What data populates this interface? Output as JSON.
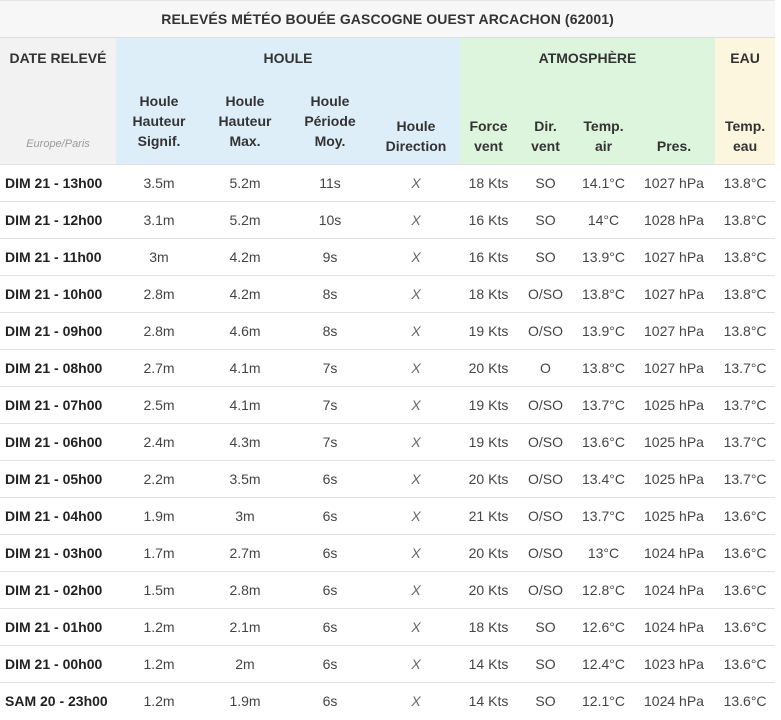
{
  "title": "RELEVÉS MÉTÉO BOUÉE GASCOGNE OUEST ARCACHON (62001)",
  "groups": {
    "date": "DATE RELEVÉ",
    "houle": "HOULE",
    "atmosphere": "ATMOSPHÈRE",
    "eau": "EAU"
  },
  "timezone": "Europe/Paris",
  "columns": {
    "hs_l1": "Houle",
    "hs_l2": "Hauteur",
    "hs_l3": "Signif.",
    "hmax_l1": "Houle",
    "hmax_l2": "Hauteur",
    "hmax_l3": "Max.",
    "per_l1": "Houle",
    "per_l2": "Période",
    "per_l3": "Moy.",
    "dir_l1": "Houle",
    "dir_l2": "Direction",
    "wind_l1": "Force",
    "wind_l2": "vent",
    "wdir_l1": "Dir.",
    "wdir_l2": "vent",
    "tair_l1": "Temp.",
    "tair_l2": "air",
    "pres": "Pres.",
    "teau_l1": "Temp.",
    "teau_l2": "eau"
  },
  "rows": [
    {
      "date": "DIM 21 - 13h00",
      "hs": "3.5m",
      "hmax": "5.2m",
      "period": "11s",
      "direction": "X",
      "wind": "18 Kts",
      "wind_dir": "SO",
      "t_air": "14.1°C",
      "pressure": "1027 hPa",
      "t_water": "13.8°C"
    },
    {
      "date": "DIM 21 - 12h00",
      "hs": "3.1m",
      "hmax": "5.2m",
      "period": "10s",
      "direction": "X",
      "wind": "16 Kts",
      "wind_dir": "SO",
      "t_air": "14°C",
      "pressure": "1028 hPa",
      "t_water": "13.8°C"
    },
    {
      "date": "DIM 21 - 11h00",
      "hs": "3m",
      "hmax": "4.2m",
      "period": "9s",
      "direction": "X",
      "wind": "16 Kts",
      "wind_dir": "SO",
      "t_air": "13.9°C",
      "pressure": "1027 hPa",
      "t_water": "13.8°C"
    },
    {
      "date": "DIM 21 - 10h00",
      "hs": "2.8m",
      "hmax": "4.2m",
      "period": "8s",
      "direction": "X",
      "wind": "18 Kts",
      "wind_dir": "O/SO",
      "t_air": "13.8°C",
      "pressure": "1027 hPa",
      "t_water": "13.8°C"
    },
    {
      "date": "DIM 21 - 09h00",
      "hs": "2.8m",
      "hmax": "4.6m",
      "period": "8s",
      "direction": "X",
      "wind": "19 Kts",
      "wind_dir": "O/SO",
      "t_air": "13.9°C",
      "pressure": "1027 hPa",
      "t_water": "13.8°C"
    },
    {
      "date": "DIM 21 - 08h00",
      "hs": "2.7m",
      "hmax": "4.1m",
      "period": "7s",
      "direction": "X",
      "wind": "20 Kts",
      "wind_dir": "O",
      "t_air": "13.8°C",
      "pressure": "1027 hPa",
      "t_water": "13.7°C"
    },
    {
      "date": "DIM 21 - 07h00",
      "hs": "2.5m",
      "hmax": "4.1m",
      "period": "7s",
      "direction": "X",
      "wind": "19 Kts",
      "wind_dir": "O/SO",
      "t_air": "13.7°C",
      "pressure": "1025 hPa",
      "t_water": "13.7°C"
    },
    {
      "date": "DIM 21 - 06h00",
      "hs": "2.4m",
      "hmax": "4.3m",
      "period": "7s",
      "direction": "X",
      "wind": "19 Kts",
      "wind_dir": "O/SO",
      "t_air": "13.6°C",
      "pressure": "1025 hPa",
      "t_water": "13.7°C"
    },
    {
      "date": "DIM 21 - 05h00",
      "hs": "2.2m",
      "hmax": "3.5m",
      "period": "6s",
      "direction": "X",
      "wind": "20 Kts",
      "wind_dir": "O/SO",
      "t_air": "13.4°C",
      "pressure": "1025 hPa",
      "t_water": "13.7°C"
    },
    {
      "date": "DIM 21 - 04h00",
      "hs": "1.9m",
      "hmax": "3m",
      "period": "6s",
      "direction": "X",
      "wind": "21 Kts",
      "wind_dir": "O/SO",
      "t_air": "13.7°C",
      "pressure": "1025 hPa",
      "t_water": "13.6°C"
    },
    {
      "date": "DIM 21 - 03h00",
      "hs": "1.7m",
      "hmax": "2.7m",
      "period": "6s",
      "direction": "X",
      "wind": "20 Kts",
      "wind_dir": "O/SO",
      "t_air": "13°C",
      "pressure": "1024 hPa",
      "t_water": "13.6°C"
    },
    {
      "date": "DIM 21 - 02h00",
      "hs": "1.5m",
      "hmax": "2.8m",
      "period": "6s",
      "direction": "X",
      "wind": "20 Kts",
      "wind_dir": "O/SO",
      "t_air": "12.8°C",
      "pressure": "1024 hPa",
      "t_water": "13.6°C"
    },
    {
      "date": "DIM 21 - 01h00",
      "hs": "1.2m",
      "hmax": "2.1m",
      "period": "6s",
      "direction": "X",
      "wind": "18 Kts",
      "wind_dir": "SO",
      "t_air": "12.6°C",
      "pressure": "1024 hPa",
      "t_water": "13.6°C"
    },
    {
      "date": "DIM 21 - 00h00",
      "hs": "1.2m",
      "hmax": "2m",
      "period": "6s",
      "direction": "X",
      "wind": "14 Kts",
      "wind_dir": "SO",
      "t_air": "12.4°C",
      "pressure": "1023 hPa",
      "t_water": "13.6°C"
    },
    {
      "date": "SAM 20 - 23h00",
      "hs": "1.2m",
      "hmax": "1.9m",
      "period": "6s",
      "direction": "X",
      "wind": "14 Kts",
      "wind_dir": "SO",
      "t_air": "12.1°C",
      "pressure": "1024 hPa",
      "t_water": "13.6°C"
    }
  ]
}
